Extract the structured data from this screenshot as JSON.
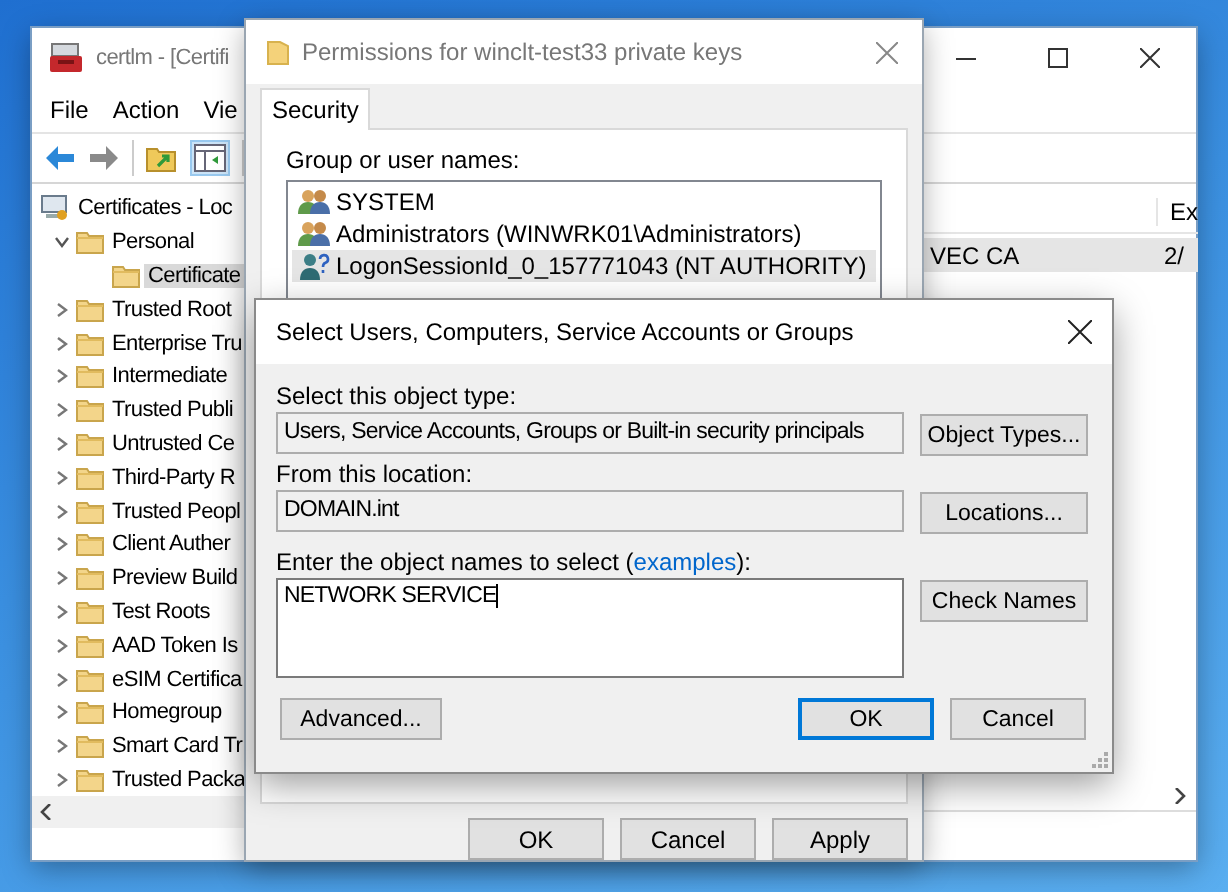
{
  "mmc_window": {
    "title": "certlm - [Certifi",
    "menu": [
      "File",
      "Action",
      "Vie"
    ],
    "tree": [
      {
        "label": "Certificates - Loc",
        "kind": "store",
        "selected": false,
        "children": [
          {
            "label": "Personal",
            "kind": "folder",
            "expanded": true,
            "selected": false,
            "children": [
              {
                "label": "Certificate",
                "kind": "folder",
                "selected": true
              }
            ]
          },
          {
            "label": "Trusted Root",
            "kind": "folder",
            "expanded": false,
            "selected": false
          },
          {
            "label": "Enterprise Tru",
            "kind": "folder",
            "expanded": false,
            "selected": false
          },
          {
            "label": "Intermediate",
            "kind": "folder",
            "expanded": false,
            "selected": false
          },
          {
            "label": "Trusted Publi",
            "kind": "folder",
            "expanded": false,
            "selected": false
          },
          {
            "label": "Untrusted Ce",
            "kind": "folder",
            "expanded": false,
            "selected": false
          },
          {
            "label": "Third-Party R",
            "kind": "folder",
            "expanded": false,
            "selected": false
          },
          {
            "label": "Trusted Peopl",
            "kind": "folder",
            "expanded": false,
            "selected": false
          },
          {
            "label": "Client Auther",
            "kind": "folder",
            "expanded": false,
            "selected": false
          },
          {
            "label": "Preview Build",
            "kind": "folder",
            "expanded": false,
            "selected": false
          },
          {
            "label": "Test Roots",
            "kind": "folder",
            "expanded": false,
            "selected": false
          },
          {
            "label": "AAD Token Is",
            "kind": "folder",
            "expanded": false,
            "selected": false
          },
          {
            "label": "eSIM Certifica",
            "kind": "folder",
            "expanded": false,
            "selected": false
          },
          {
            "label": "Homegroup",
            "kind": "folder",
            "expanded": false,
            "selected": false
          },
          {
            "label": "Smart Card Tr",
            "kind": "folder",
            "expanded": false,
            "selected": false
          },
          {
            "label": "Trusted Packa",
            "kind": "folder",
            "expanded": false,
            "selected": false
          }
        ]
      }
    ],
    "list": {
      "columns": [
        "",
        "Ex"
      ],
      "rows": [
        {
          "cells": [
            "VEC CA",
            "2/"
          ],
          "selected": true
        }
      ]
    }
  },
  "permissions_window": {
    "title": "Permissions for winclt-test33 private keys",
    "tabs": [
      {
        "label": "Security",
        "selected": true
      }
    ],
    "group_label": "Group or user names:",
    "principals": [
      {
        "name": "SYSTEM",
        "kind": "group",
        "selected": false
      },
      {
        "name": "Administrators (WINWRK01\\Administrators)",
        "kind": "group",
        "selected": false
      },
      {
        "name": "LogonSessionId_0_157771043 (NT AUTHORITY)",
        "kind": "unknown",
        "selected": true
      }
    ],
    "buttons": [
      {
        "label": "OK"
      },
      {
        "label": "Cancel"
      },
      {
        "label": "Apply"
      }
    ]
  },
  "select_dialog": {
    "title": "Select Users, Computers, Service Accounts or Groups",
    "object_type": {
      "label": "Select this object type:",
      "value": "Users, Service Accounts, Groups or Built-in security principals",
      "button": "Object Types..."
    },
    "location": {
      "label": "From this location:",
      "value": "DOMAIN.int",
      "button": "Locations..."
    },
    "names": {
      "label_before": "Enter the object names to select (",
      "link": "examples",
      "label_after": "):",
      "value": "NETWORK SERVICE",
      "button": "Check Names"
    },
    "buttons": [
      {
        "label": "Advanced...",
        "default": false
      },
      {
        "label": "OK",
        "default": true
      },
      {
        "label": "Cancel",
        "default": false
      }
    ]
  }
}
